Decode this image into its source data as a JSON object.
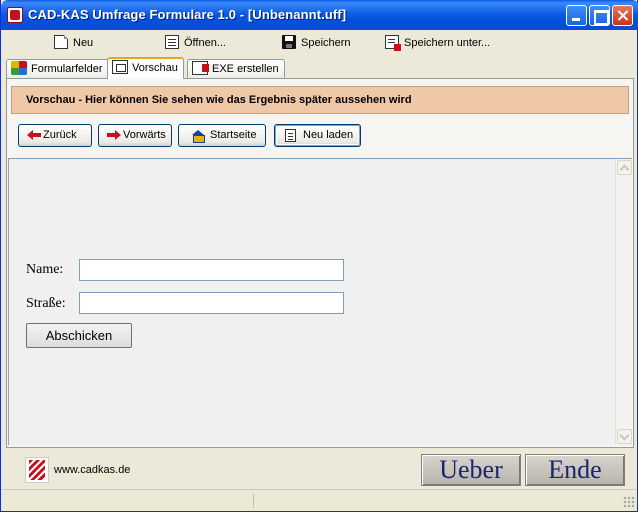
{
  "window": {
    "title": "CAD-KAS Umfrage Formulare 1.0 - [Unbenannt.uff]"
  },
  "toolbar": {
    "new_label": "Neu",
    "open_label": "Öffnen...",
    "save_label": "Speichern",
    "save_as_label": "Speichern unter..."
  },
  "tabs": [
    {
      "label": "Formularfelder",
      "active": false
    },
    {
      "label": "Vorschau",
      "active": true
    },
    {
      "label": "EXE erstellen",
      "active": false
    }
  ],
  "preview": {
    "info_text": "Vorschau - Hier können Sie sehen wie das Ergebnis später aussehen wird",
    "nav": {
      "back_label": "Zurück",
      "forward_label": "Vorwärts",
      "home_label": "Startseite",
      "reload_label": "Neu laden"
    },
    "form": {
      "name_label": "Name:",
      "name_value": "",
      "street_label": "Straße:",
      "street_value": "",
      "submit_label": "Abschicken"
    }
  },
  "footer": {
    "url": "www.cadkas.de",
    "about_label": "Ueber",
    "exit_label": "Ende"
  },
  "colors": {
    "titlebar": "#0a5de8",
    "info_bar": "#f0c8a8",
    "big_button_text": "#1a2470"
  },
  "icons": {
    "new": "new-document-icon",
    "open": "open-document-icon",
    "save": "floppy-disk-icon",
    "save_as": "save-as-icon",
    "back": "arrow-left-icon",
    "forward": "arrow-right-icon",
    "home": "house-icon",
    "reload": "reload-document-icon"
  }
}
